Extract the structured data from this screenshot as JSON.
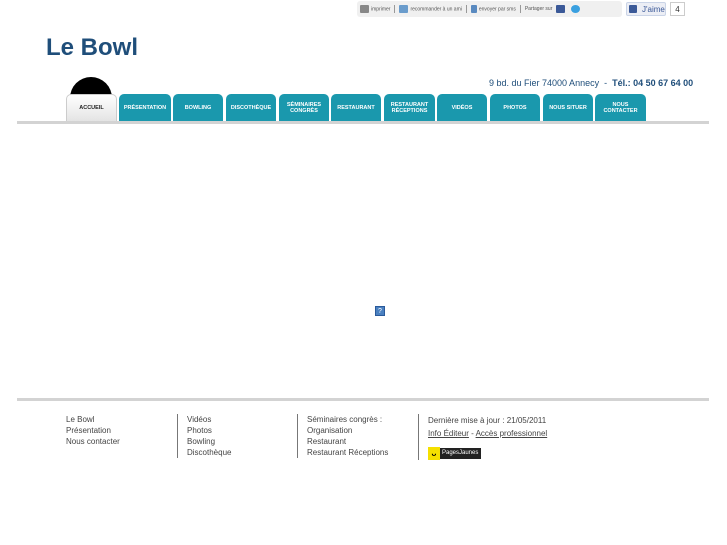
{
  "toolbar": {
    "print": "imprimer",
    "recommend": "recommander à un ami",
    "send": "envoyer par sms",
    "share": "Partager sur",
    "like": "J'aime",
    "like_count": "4"
  },
  "logo": "Le Bowl",
  "address": "9 bd. du Fier 74000 Annecy",
  "phone": "Tél.: 04 50 67 64 00",
  "tabs": [
    "ACCUEIL",
    "PRÉSENTATION",
    "BOWLING",
    "DISCOTHÈQUE",
    "SÉMINAIRES\nCONGRÈS",
    "RESTAURANT",
    "RESTAURANT\nRÉCEPTIONS",
    "VIDÉOS",
    "PHOTOS",
    "NOUS SITUER",
    "NOUS\nCONTACTER"
  ],
  "flash_placeholder": "?",
  "footer": {
    "col1": [
      "Le Bowl",
      "Présentation",
      "Nous contacter"
    ],
    "col2": [
      "Vidéos",
      "Photos",
      "Bowling",
      "Discothèque"
    ],
    "col3": [
      "Séminaires congrès :",
      "Organisation",
      "Restaurant",
      "Restaurant Réceptions"
    ],
    "updated": "Dernière mise à jour : 21/05/2011",
    "info_editeur": "Info Éditeur",
    "acces_pro": "Accès professionnel",
    "pagesjaunes": "PagesJaunes"
  }
}
